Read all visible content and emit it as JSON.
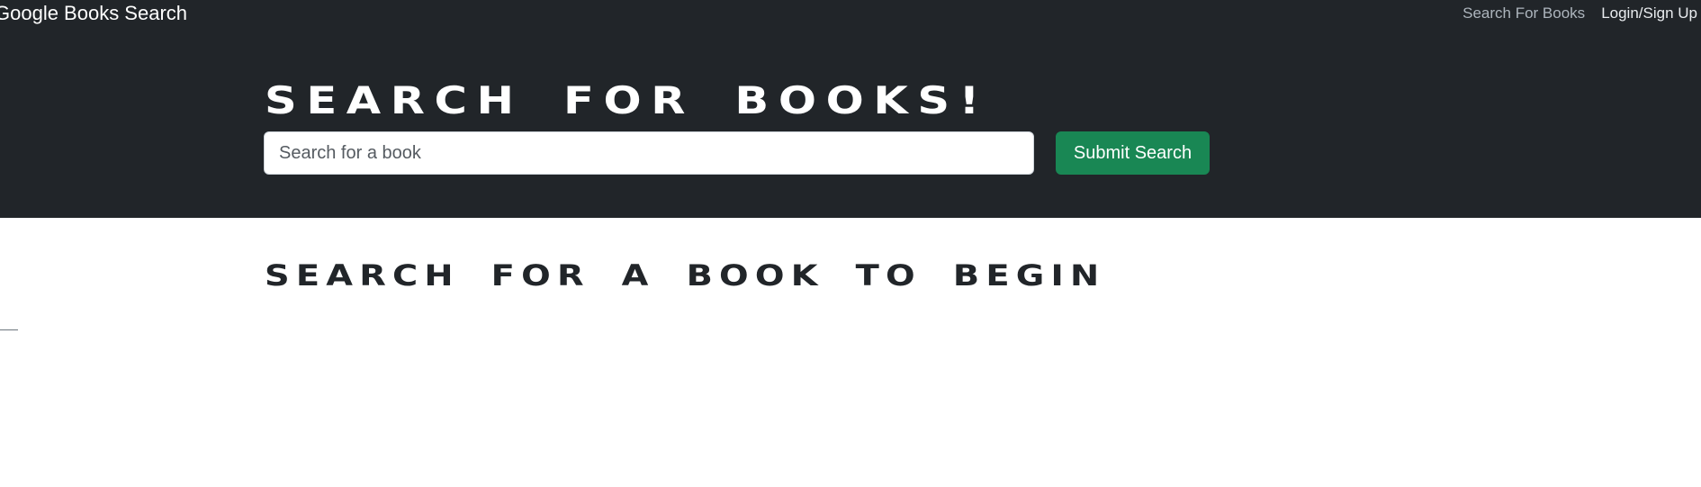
{
  "navbar": {
    "brand": "Google Books Search",
    "links": [
      {
        "label": "Search For Books",
        "state": "muted"
      },
      {
        "label": "Login/Sign Up",
        "state": "normal"
      }
    ]
  },
  "hero": {
    "title": "SEARCH FOR BOOKS!",
    "search": {
      "value": "",
      "placeholder": "Search for a book"
    },
    "submit_label": "Submit Search"
  },
  "results": {
    "title": "SEARCH FOR A BOOK TO BEGIN"
  },
  "colors": {
    "header_bg": "#212529",
    "button_bg": "#198754",
    "page_bg": "#ffffff"
  }
}
